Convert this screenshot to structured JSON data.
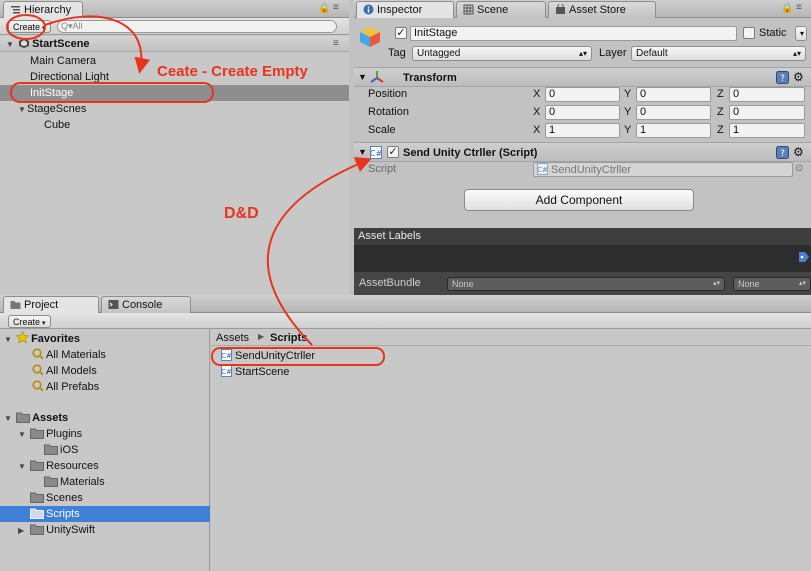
{
  "hierarchy": {
    "tab": "Hierarchy",
    "create": "Create",
    "search_placeholder": "Q▾All",
    "scene": "StartScene",
    "items": [
      "Main Camera",
      "Directional Light",
      "InitStage",
      "StageScnes",
      "Cube"
    ]
  },
  "inspector": {
    "tabs": [
      "Inspector",
      "Scene",
      "Asset Store"
    ],
    "object_name": "InitStage",
    "static_label": "Static",
    "tag_label": "Tag",
    "tag_value": "Untagged",
    "layer_label": "Layer",
    "layer_value": "Default",
    "transform": {
      "title": "Transform",
      "rows": [
        {
          "label": "Position",
          "x": "0",
          "y": "0",
          "z": "0"
        },
        {
          "label": "Rotation",
          "x": "0",
          "y": "0",
          "z": "0"
        },
        {
          "label": "Scale",
          "x": "1",
          "y": "1",
          "z": "1"
        }
      ],
      "axes": [
        "X",
        "Y",
        "Z"
      ]
    },
    "script_component": {
      "title": "Send Unity Ctrller (Script)",
      "script_label": "Script",
      "script_value": "SendUnityCtrller"
    },
    "add_component": "Add Component",
    "asset_labels": {
      "title": "Asset Labels",
      "assetbundle_label": "AssetBundle",
      "bundle_value": "None",
      "variant_value": "None"
    }
  },
  "project": {
    "tabs": [
      "Project",
      "Console"
    ],
    "create": "Create",
    "favorites": {
      "title": "Favorites",
      "items": [
        "All Materials",
        "All Models",
        "All Prefabs"
      ]
    },
    "assets": {
      "title": "Assets",
      "tree": [
        "Plugins",
        "iOS",
        "Resources",
        "Materials",
        "Scenes",
        "Scripts",
        "UnitySwift"
      ]
    },
    "breadcrumb": {
      "root": "Assets",
      "current": "Scripts"
    },
    "files": [
      "SendUnityCtrller",
      "StartScene"
    ]
  },
  "annotations": {
    "create_empty": "Ceate - Create Empty",
    "drag_drop": "D&D"
  },
  "colors": {
    "annotation": "#e8341c",
    "selection": "#3d80d6",
    "hier_selection": "#8e8e8e"
  }
}
